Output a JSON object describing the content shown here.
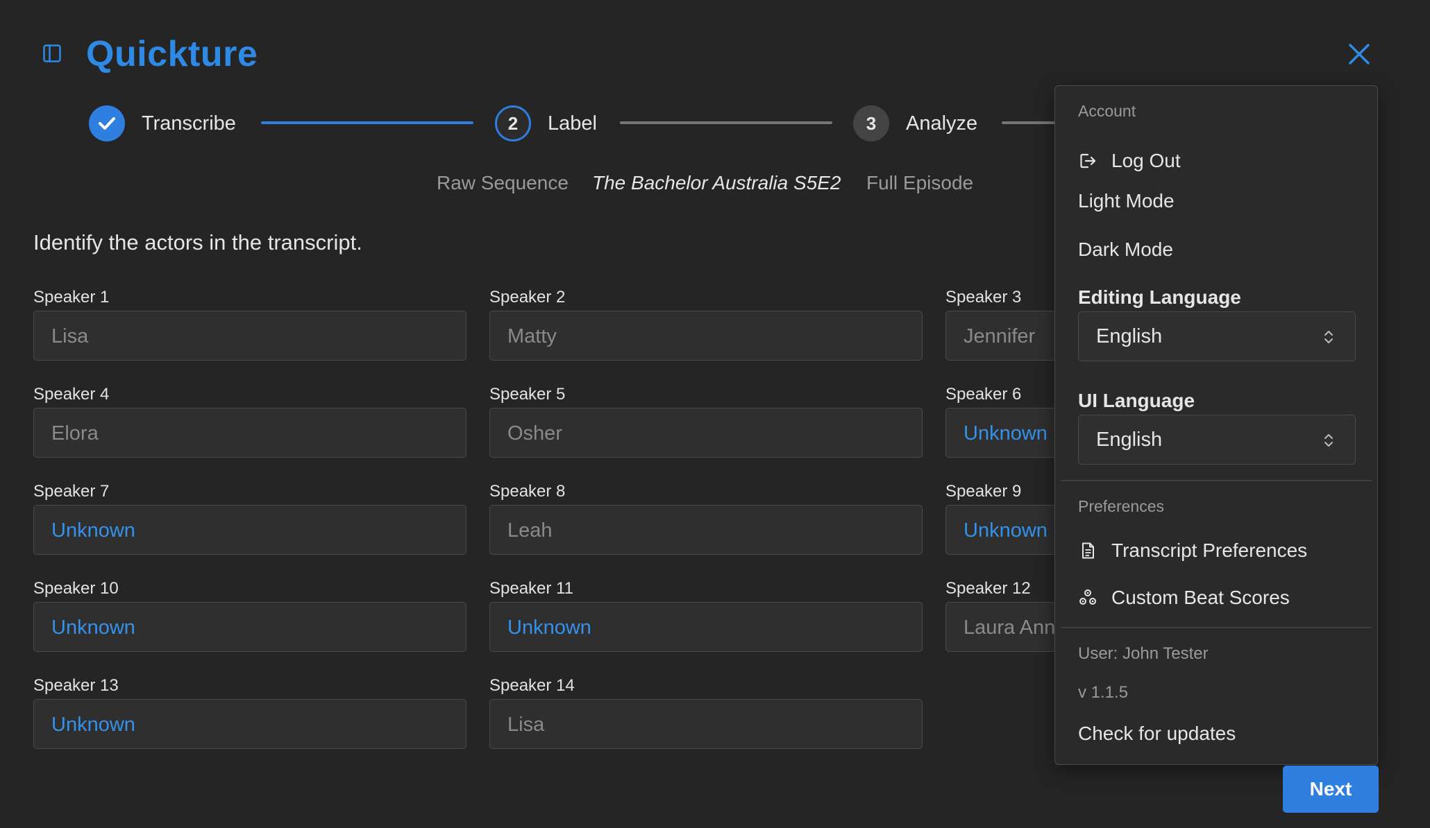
{
  "app": {
    "title": "Quickture"
  },
  "stepper": {
    "steps": [
      {
        "number": "1",
        "label": "Transcribe",
        "state": "done"
      },
      {
        "number": "2",
        "label": "Label",
        "state": "active"
      },
      {
        "number": "3",
        "label": "Analyze",
        "state": "todo"
      }
    ]
  },
  "subheader": {
    "items": [
      "Raw Sequence",
      "The Bachelor Australia S5E2",
      "Full Episode"
    ]
  },
  "main": {
    "instructions": "Identify the actors in the transcript.",
    "speakers": [
      {
        "label": "Speaker 1",
        "value": "Lisa"
      },
      {
        "label": "Speaker 2",
        "value": "Matty"
      },
      {
        "label": "Speaker 3",
        "value": "Jennifer"
      },
      {
        "label": "Speaker 4",
        "value": "Elora"
      },
      {
        "label": "Speaker 5",
        "value": "Osher"
      },
      {
        "label": "Speaker 6",
        "value": "Unknown"
      },
      {
        "label": "Speaker 7",
        "value": "Unknown"
      },
      {
        "label": "Speaker 8",
        "value": "Leah"
      },
      {
        "label": "Speaker 9",
        "value": "Unknown"
      },
      {
        "label": "Speaker 10",
        "value": "Unknown"
      },
      {
        "label": "Speaker 11",
        "value": "Unknown"
      },
      {
        "label": "Speaker 12",
        "value": "Laura Ann"
      },
      {
        "label": "Speaker 13",
        "value": "Unknown"
      },
      {
        "label": "Speaker 14",
        "value": "Lisa"
      }
    ]
  },
  "menu": {
    "account_header": "Account",
    "log_out": "Log Out",
    "light_mode": "Light Mode",
    "dark_mode": "Dark Mode",
    "editing_language_label": "Editing Language",
    "editing_language_value": "English",
    "ui_language_label": "UI Language",
    "ui_language_value": "English",
    "preferences_header": "Preferences",
    "transcript_preferences": "Transcript Preferences",
    "custom_beat_scores": "Custom Beat Scores",
    "user": "User: John Tester",
    "version": "v 1.1.5",
    "check_updates": "Check for updates"
  },
  "footer": {
    "next_label": "Next"
  },
  "colors": {
    "accent": "#2f7fe0",
    "unknown_text": "#3591ea",
    "background": "#252525",
    "panel": "#2a2a2a"
  },
  "icons": [
    "sidebar-toggle-icon",
    "close-icon",
    "checkmark-icon",
    "log-out-icon",
    "document-icon",
    "beat-scores-icon",
    "chevron-updown-icon"
  ]
}
